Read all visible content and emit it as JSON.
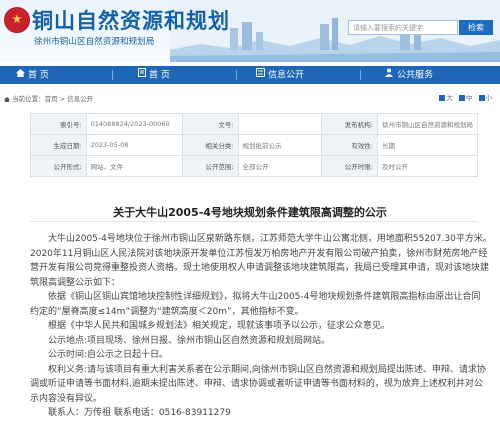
{
  "header": {
    "title": "铜山自然资源和规划",
    "subtitle": "徐州市铜山区自然资源和规划局",
    "search_placeholder": "请输入要搜索的关键字",
    "search_button": "检索",
    "brand_color": "#1460aa"
  },
  "nav": {
    "items": [
      {
        "label": "首  页",
        "icon": "home-icon"
      },
      {
        "label": "首  页",
        "icon": "doc-icon"
      },
      {
        "label": "信息公开",
        "icon": "info-icon"
      },
      {
        "label": "公共服务",
        "icon": "people-icon"
      }
    ]
  },
  "breadcrumb": {
    "label": "当前位置：",
    "home": "首页",
    "separator": " > ",
    "current": "信息公开"
  },
  "font_controls": [
    "大",
    "中",
    "小"
  ],
  "info": {
    "index_label": "索引号:",
    "index_value": "014088824/2023-00060",
    "docno_label": "文号:",
    "docno_value": "",
    "publisher_label": "发布机构:",
    "publisher_value": "徐州市铜山区自然资源和规划局",
    "date_label": "生成日期:",
    "date_value": "2023-05-08",
    "category_label": "相关分类:",
    "category_value": "规划批前公示",
    "validity_label": "有效性:",
    "validity_value": "长期",
    "form_label": "公开形式:",
    "form_value": "网站、文件",
    "scope_label": "公开范围:",
    "scope_value": "全部公开",
    "period_label": "公开时限:",
    "period_value": "及时公开"
  },
  "article": {
    "title": "关于大牛山2005-4号地块规划条件建筑限高调整的公示",
    "lines": [
      "大牛山2005-4号地块位于徐州市铜山区泉新路东侧，江苏师范大学牛山公寓北侧，用地面积55207.30平方米。",
      "2020年11月铜山区人民法院对该地块原开发单位江苏恒发万柏房地产开发有限公司破产拍卖，徐州市财苑房地产经",
      "营开发有限公司竞得重整投资人资格。现土地使用权人申请调整该地块建筑限高，我局已受理其申请，现对该地块建",
      "筑限高调整公示如下：",
      "依据《铜山区铜山宾馆地块控制性详细规划》，拟将大牛山2005-4号地块规划条件建筑限高指标由原出让合同",
      "约定的“屋脊高度≤14m”调整为“建筑高度＜20m”，其他指标不变。",
      "根据《中华人民共和国城乡规划法》相关规定，现就该事项予以公示，征求公众意见。",
      "公示地点:项目现场、徐州日报、徐州市铜山区自然资源和规划局网站。",
      "公示时间:自公示之日起十日。",
      "权利义务:请与该项目有重大利害关系者在公示期间,向徐州市铜山区自然资源和规划局提出陈述、申辩、请求协",
      "调或听证申请等书面材料,逾期未提出陈述、申辩、请求协调或者听证申请等书面材料的，视为放弃上述权利并对公",
      "示内容没有异议。",
      "联系人：万传祖    联系电话：0516-83911279"
    ]
  }
}
